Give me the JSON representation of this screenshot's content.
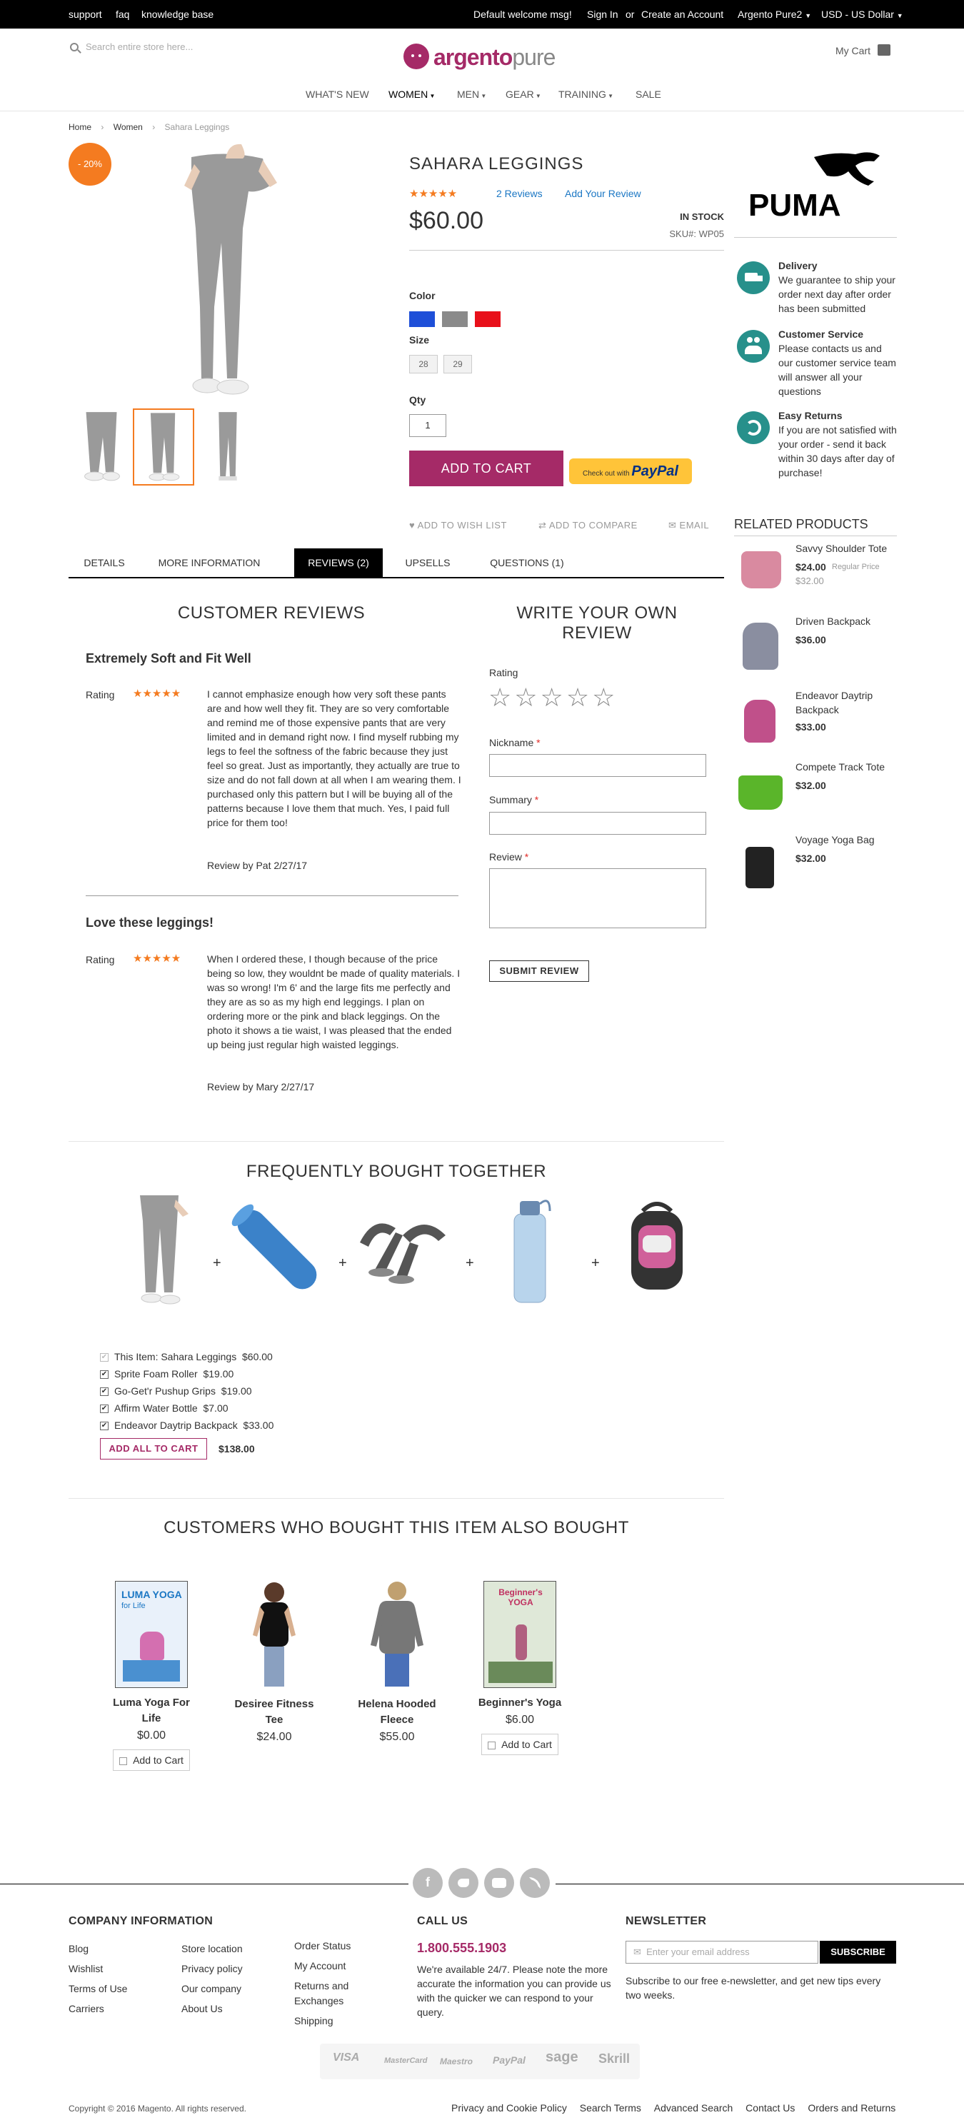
{
  "topbar": {
    "support": "support",
    "faq": "faq",
    "kb": "knowledge base",
    "welcome": "Default welcome msg!",
    "signin": "Sign In",
    "or": "or",
    "create": "Create an Account",
    "store": "Argento Pure2",
    "currency": "USD - US Dollar"
  },
  "header": {
    "search_placeholder": "Search entire store here...",
    "logo_a": "argento",
    "logo_b": "pure",
    "cart": "My Cart"
  },
  "nav": [
    "WHAT'S NEW",
    "WOMEN",
    "MEN",
    "GEAR",
    "TRAINING",
    "SALE"
  ],
  "breadcrumb": {
    "home": "Home",
    "women": "Women",
    "current": "Sahara Leggings"
  },
  "product": {
    "badge": "- 20%",
    "name": "SAHARA LEGGINGS",
    "stars": "★★★★★",
    "reviews_link": "2 Reviews",
    "add_review": "Add Your Review",
    "price": "$60.00",
    "stock": "IN STOCK",
    "sku_label": "SKU#:",
    "sku": "WP05",
    "color_label": "Color",
    "colors": [
      "#1e4fd8",
      "#8a8a8a",
      "#e8101a"
    ],
    "size_label": "Size",
    "sizes": [
      "28",
      "29"
    ],
    "qty_label": "Qty",
    "qty": "1",
    "add_to_cart": "ADD TO CART",
    "paypal_pre": "Check out with",
    "paypal": "PayPal",
    "wishlist": "ADD TO WISH LIST",
    "compare": "ADD TO COMPARE",
    "email": "EMAIL"
  },
  "tabs": [
    "DETAILS",
    "MORE INFORMATION",
    "REVIEWS (2)",
    "UPSELLS",
    "QUESTIONS (1)"
  ],
  "reviews": {
    "heading": "CUSTOMER REVIEWS",
    "items": [
      {
        "title": "Extremely Soft and Fit Well",
        "rating_label": "Rating",
        "stars": "★★★★★",
        "text": "I cannot emphasize enough how very soft these pants are and how well they fit. They are so very comfortable and remind me of those expensive pants that are very limited and in demand right now. I find myself rubbing my legs to feel the softness of the fabric because they just feel so great. Just as importantly, they actually are true to size and do not fall down at all when I am wearing them. I purchased only this pattern but I will be buying all of the patterns because I love them that much. Yes, I paid full price for them too!",
        "by": "Review by Pat 2/27/17"
      },
      {
        "title": "Love these leggings!",
        "rating_label": "Rating",
        "stars": "★★★★★",
        "text": "When I ordered these, I though because of the price being so low, they wouldnt be made of quality materials. I was so wrong! I'm 6' and the large fits me perfectly and they are as so as my high end leggings. I plan on ordering more or the pink and black leggings. On the photo it shows a tie waist, I was pleased that the ended up being just regular high waisted leggings.",
        "by": "Review by Mary 2/27/17"
      }
    ]
  },
  "write": {
    "heading_1": "WRITE YOUR OWN",
    "heading_2": "REVIEW",
    "rating": "Rating",
    "nickname": "Nickname",
    "summary": "Summary",
    "review": "Review",
    "req": "*",
    "submit": "SUBMIT REVIEW"
  },
  "brand": "PUMA",
  "perks": [
    {
      "title": "Delivery",
      "text": "We guarantee to ship your order next day after order has been submitted",
      "icon": "truck-icon"
    },
    {
      "title": "Customer Service",
      "text": "Please contacts us and our customer service team will answer all your questions",
      "icon": "people-icon"
    },
    {
      "title": "Easy Returns",
      "text": "If you are not satisfied with your order - send it back within 30 days after day of purchase!",
      "icon": "return-icon"
    }
  ],
  "related": {
    "heading": "RELATED PRODUCTS",
    "items": [
      {
        "name": "Savvy Shoulder Tote",
        "price": "$24.00",
        "regular_label": "Regular Price",
        "regular": "$32.00",
        "color": "#d98aa0"
      },
      {
        "name": "Driven Backpack",
        "price": "$36.00",
        "color": "#8a8ea0"
      },
      {
        "name": "Endeavor Daytrip Backpack",
        "price": "$33.00",
        "color": "#c0508a"
      },
      {
        "name": "Compete Track Tote",
        "price": "$32.00",
        "color": "#5ab52a"
      },
      {
        "name": "Voyage Yoga Bag",
        "price": "$32.00",
        "color": "#222222"
      }
    ]
  },
  "fbt": {
    "heading": "FREQUENTLY BOUGHT TOGETHER",
    "plus": "+",
    "items": [
      {
        "name": "This Item: Sahara Leggings",
        "price": "$60.00"
      },
      {
        "name": "Sprite Foam Roller",
        "price": "$19.00"
      },
      {
        "name": "Go-Get'r Pushup Grips",
        "price": "$19.00"
      },
      {
        "name": "Affirm Water Bottle",
        "price": "$7.00"
      },
      {
        "name": "Endeavor Daytrip Backpack",
        "price": "$33.00"
      }
    ],
    "add_all": "ADD ALL TO CART",
    "total": "$138.00"
  },
  "also": {
    "heading": "CUSTOMERS WHO BOUGHT THIS ITEM ALSO BOUGHT",
    "items": [
      {
        "name1": "Luma Yoga For",
        "name2": "Life",
        "price": "$0.00",
        "cover_title": "LUMA YOGA",
        "cover_sub": "for Life"
      },
      {
        "name1": "Desiree Fitness",
        "name2": "Tee",
        "price": "$24.00"
      },
      {
        "name1": "Helena Hooded",
        "name2": "Fleece",
        "price": "$55.00"
      },
      {
        "name1": "Beginner's Yoga",
        "name2": "",
        "price": "$6.00",
        "cover_title": "Beginner's YOGA"
      }
    ],
    "add_to_cart": "Add to Cart"
  },
  "footer": {
    "company_heading": "COMPANY INFORMATION",
    "col1": [
      "Blog",
      "Wishlist",
      "Terms of Use",
      "Carriers"
    ],
    "col2": [
      "Store location",
      "Privacy policy",
      "Our company",
      "About Us"
    ],
    "col3": [
      "Order Status",
      "My Account",
      "Returns and",
      "Exchanges",
      "Shipping"
    ],
    "call_heading": "CALL US",
    "phone": "1.800.555.1903",
    "call_text": "We're available 24/7. Please note the more accurate the information you can provide us with the quicker we can respond to your query.",
    "news_heading": "NEWSLETTER",
    "news_placeholder": "Enter your email address",
    "subscribe": "SUBSCRIBE",
    "news_text": "Subscribe to our free e-newsletter, and get new tips every two weeks.",
    "cards": [
      "VISA",
      "MasterCard",
      "Maestro",
      "PayPal",
      "sage",
      "Skrill"
    ],
    "copyright": "Copyright © 2016 Magento. All rights reserved.",
    "links": [
      "Privacy and Cookie Policy",
      "Search Terms",
      "Advanced Search",
      "Contact Us",
      "Orders and Returns"
    ]
  }
}
